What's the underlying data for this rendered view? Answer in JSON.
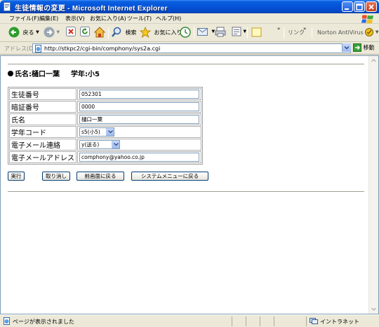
{
  "window": {
    "title": "生徒情報の変更 - Microsoft Internet Explorer"
  },
  "menu": [
    "ファイル(F)",
    "編集(E)",
    "表示(V)",
    "お気に入り(A)",
    "ツール(T)",
    "ヘルプ(H)"
  ],
  "toolbar": {
    "back": "戻る",
    "search": "検索",
    "favorites": "お気に入り",
    "links": "リンク",
    "norton": "Norton AntiVirus"
  },
  "address": {
    "label": "アドレス(D)",
    "url": "http://stkpc2/cgi-bin/comphony/sys2a.cgi",
    "go": "移動"
  },
  "page": {
    "heading_name": "氏名:樋口一葉",
    "heading_grade": "学年:小5",
    "fields": [
      {
        "label": "生徒番号",
        "value": "052301"
      },
      {
        "label": "暗証番号",
        "value": "0000"
      },
      {
        "label": "氏名",
        "value": "樋口一葉"
      },
      {
        "label": "学年コード",
        "value": "s5(小5)"
      },
      {
        "label": "電子メール連絡",
        "value": "y(送る)"
      },
      {
        "label": "電子メールアドレス",
        "value": "comphony@yahoo.co.jp"
      }
    ],
    "buttons": {
      "submit": "実行",
      "cancel": "取り消し",
      "back": "前画面に戻る",
      "system_menu": "システムメニューに戻る"
    }
  },
  "status": {
    "text": "ページが表示されました",
    "zone": "イントラネット"
  }
}
